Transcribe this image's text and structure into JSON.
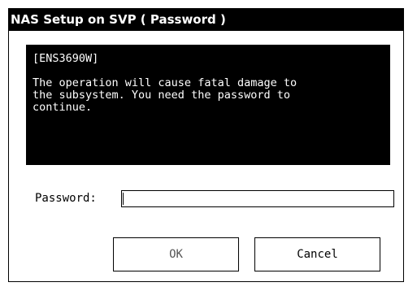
{
  "window": {
    "title": "NAS Setup on SVP ( Password )"
  },
  "message": {
    "code": "[ENS3690W]",
    "text": "The operation will cause fatal damage to\nthe subsystem. You need the password to\ncontinue."
  },
  "password": {
    "label": "Password:",
    "value": ""
  },
  "buttons": {
    "ok": "OK",
    "cancel": "Cancel"
  },
  "colors": {
    "titlebar_bg": "#000000",
    "message_bg": "#000000",
    "text_light": "#ffffff"
  }
}
